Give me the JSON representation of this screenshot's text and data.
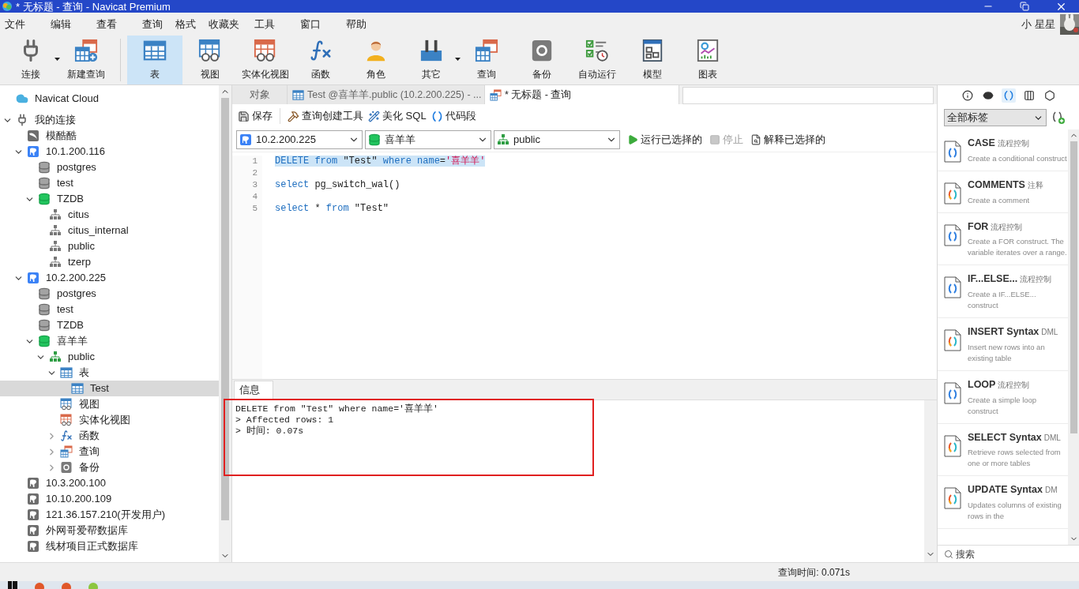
{
  "window": {
    "title": "* 无标题 - 查询 - Navicat Premium"
  },
  "menu": [
    "文件",
    "编辑",
    "查看",
    "查询",
    "格式",
    "收藏夹",
    "工具",
    "窗口",
    "帮助"
  ],
  "user": {
    "name": "小 星星"
  },
  "toolbar": [
    {
      "label": "连接",
      "kind": "connect",
      "dropdown": true,
      "selected": false
    },
    {
      "label": "新建查询",
      "kind": "newquery",
      "dropdown": false,
      "selected": false
    },
    {
      "label": "表",
      "kind": "table",
      "dropdown": false,
      "selected": true
    },
    {
      "label": "视图",
      "kind": "view",
      "dropdown": false,
      "selected": false
    },
    {
      "label": "实体化视图",
      "kind": "matview",
      "dropdown": false,
      "selected": false
    },
    {
      "label": "函数",
      "kind": "function",
      "dropdown": false,
      "selected": false
    },
    {
      "label": "角色",
      "kind": "role",
      "dropdown": false,
      "selected": false
    },
    {
      "label": "其它",
      "kind": "other",
      "dropdown": true,
      "selected": false
    },
    {
      "label": "查询",
      "kind": "query",
      "dropdown": false,
      "selected": false
    },
    {
      "label": "备份",
      "kind": "backup",
      "dropdown": false,
      "selected": false
    },
    {
      "label": "自动运行",
      "kind": "autorun",
      "dropdown": false,
      "selected": false
    },
    {
      "label": "模型",
      "kind": "model",
      "dropdown": false,
      "selected": false
    },
    {
      "label": "图表",
      "kind": "chart",
      "dropdown": false,
      "selected": false
    }
  ],
  "sidebar": {
    "tree": [
      {
        "label": "Navicat Cloud",
        "kind": "cloud",
        "selected": false
      },
      {
        "label": "我的连接",
        "kind": "connections",
        "expanded": true,
        "selected": false,
        "children": [
          {
            "label": "模酷酷",
            "kind": "mysql",
            "selected": false
          },
          {
            "label": "10.1.200.116",
            "kind": "pg",
            "open": true,
            "expanded": true,
            "selected": false,
            "children": [
              {
                "label": "postgres",
                "kind": "db",
                "open": false,
                "selected": false
              },
              {
                "label": "test",
                "kind": "db",
                "open": false,
                "selected": false
              },
              {
                "label": "TZDB",
                "kind": "db",
                "open": true,
                "expanded": true,
                "selected": false,
                "children": [
                  {
                    "label": "citus",
                    "kind": "schema",
                    "open": false,
                    "selected": false
                  },
                  {
                    "label": "citus_internal",
                    "kind": "schema",
                    "open": false,
                    "selected": false
                  },
                  {
                    "label": "public",
                    "kind": "schema",
                    "open": false,
                    "selected": false
                  },
                  {
                    "label": "tzerp",
                    "kind": "schema",
                    "open": false,
                    "selected": false
                  }
                ]
              }
            ]
          },
          {
            "label": "10.2.200.225",
            "kind": "pg",
            "open": true,
            "expanded": true,
            "selected": false,
            "children": [
              {
                "label": "postgres",
                "kind": "db",
                "open": false,
                "selected": false
              },
              {
                "label": "test",
                "kind": "db",
                "open": false,
                "selected": false
              },
              {
                "label": "TZDB",
                "kind": "db",
                "open": false,
                "selected": false
              },
              {
                "label": "喜羊羊",
                "kind": "db",
                "open": true,
                "expanded": true,
                "selected": false,
                "children": [
                  {
                    "label": "public",
                    "kind": "schema",
                    "open": true,
                    "expanded": true,
                    "selected": false,
                    "children": [
                      {
                        "label": "表",
                        "kind": "table",
                        "expanded": true,
                        "selected": false,
                        "children": [
                          {
                            "label": "Test",
                            "kind": "table",
                            "selected": true
                          }
                        ]
                      },
                      {
                        "label": "视图",
                        "kind": "view",
                        "selected": false
                      },
                      {
                        "label": "实体化视图",
                        "kind": "matview",
                        "selected": false
                      },
                      {
                        "label": "函数",
                        "kind": "function",
                        "expanded": false,
                        "selected": false
                      },
                      {
                        "label": "查询",
                        "kind": "query",
                        "expanded": false,
                        "selected": false
                      },
                      {
                        "label": "备份",
                        "kind": "backup",
                        "expanded": false,
                        "selected": false
                      }
                    ]
                  }
                ]
              }
            ]
          },
          {
            "label": "10.3.200.100",
            "kind": "pg",
            "open": false,
            "selected": false
          },
          {
            "label": "10.10.200.109",
            "kind": "pg",
            "open": false,
            "selected": false
          },
          {
            "label": "121.36.157.210(开发用户)",
            "kind": "pg",
            "open": false,
            "selected": false
          },
          {
            "label": "外网哥爱帮数据库",
            "kind": "pg",
            "open": false,
            "selected": false
          },
          {
            "label": "线材项目正式数据库",
            "kind": "pg",
            "open": false,
            "selected": false
          }
        ]
      }
    ]
  },
  "editor": {
    "tabs": [
      {
        "label": "对象",
        "kind": "objects",
        "selected": false
      },
      {
        "label": "Test @喜羊羊.public (10.2.200.225) - ...",
        "kind": "table",
        "selected": false
      },
      {
        "label": "* 无标题 - 查询",
        "kind": "query",
        "selected": true
      }
    ],
    "actions": [
      {
        "label": "保存",
        "kind": "save"
      },
      {
        "label": "查询创建工具",
        "kind": "builder"
      },
      {
        "label": "美化 SQL",
        "kind": "beautify"
      },
      {
        "label": "代码段",
        "kind": "snippet"
      }
    ],
    "selectors": [
      {
        "value": "10.2.200.225",
        "kind": "pg"
      },
      {
        "value": "喜羊羊",
        "kind": "db"
      },
      {
        "value": "public",
        "kind": "schema"
      }
    ],
    "run_actions": [
      {
        "label": "运行已选择的",
        "kind": "run",
        "disabled": false
      },
      {
        "label": "停止",
        "kind": "stop",
        "disabled": true
      },
      {
        "label": "解释已选择的",
        "kind": "explain",
        "disabled": false
      }
    ],
    "lines": [
      {
        "number": "1",
        "selected": true,
        "tokens": [
          {
            "text": "DELETE from",
            "kind": "keyword"
          },
          {
            "text": " \"Test\" ",
            "kind": "plain"
          },
          {
            "text": "where name",
            "kind": "keyword"
          },
          {
            "text": "=",
            "kind": "plain"
          },
          {
            "text": "'喜羊羊'",
            "kind": "string"
          }
        ]
      },
      {
        "number": "2",
        "selected": false
      },
      {
        "number": "3",
        "selected": false,
        "tokens": [
          {
            "text": "select",
            "kind": "keyword"
          },
          {
            "text": " pg_switch_wal()",
            "kind": "plain"
          }
        ]
      },
      {
        "number": "4",
        "selected": false
      },
      {
        "number": "5",
        "selected": false,
        "tokens": [
          {
            "text": "select",
            "kind": "keyword"
          },
          {
            "text": " * ",
            "kind": "plain"
          },
          {
            "text": "from",
            "kind": "keyword"
          },
          {
            "text": " \"Test\"",
            "kind": "plain"
          }
        ]
      }
    ]
  },
  "results": {
    "tabs": [
      {
        "label": "信息",
        "selected": true
      }
    ],
    "output": [
      "DELETE from \"Test\" where name='喜羊羊'",
      "> Affected rows: 1",
      "> 时间: 0.07s"
    ]
  },
  "snippets": {
    "tool_icons": [
      {
        "kind": "info",
        "selected": false
      },
      {
        "kind": "eye",
        "selected": false
      },
      {
        "kind": "snippet",
        "selected": true
      },
      {
        "kind": "columns",
        "selected": false
      },
      {
        "kind": "hexagon",
        "selected": false
      }
    ],
    "filter": "全部标签",
    "items": [
      {
        "title": "CASE",
        "tag": "流程控制",
        "kind": "control",
        "description": "Create a conditional construct"
      },
      {
        "title": "COMMENTS",
        "tag": "注释",
        "kind": "syntax",
        "description": "Create a comment"
      },
      {
        "title": "FOR",
        "tag": "流程控制",
        "kind": "control",
        "description": "Create a FOR construct. The variable iterates over a range."
      },
      {
        "title": "IF...ELSE...",
        "tag": "流程控制",
        "kind": "control",
        "description": "Create a IF...ELSE... construct"
      },
      {
        "title": "INSERT Syntax",
        "tag": "DML",
        "kind": "syntax",
        "description": "Insert new rows into an existing table"
      },
      {
        "title": "LOOP",
        "tag": "流程控制",
        "kind": "control",
        "description": "Create a simple loop construct"
      },
      {
        "title": "SELECT Syntax",
        "tag": "DML",
        "kind": "syntax",
        "description": "Retrieve rows selected from one or more tables"
      },
      {
        "title": "UPDATE Syntax",
        "tag": "DM",
        "kind": "syntax",
        "description": "Updates columns of existing rows in the"
      }
    ],
    "search": {
      "placeholder": "搜索"
    }
  },
  "status_bar": {
    "query_time": "查询时间: 0.071s"
  }
}
